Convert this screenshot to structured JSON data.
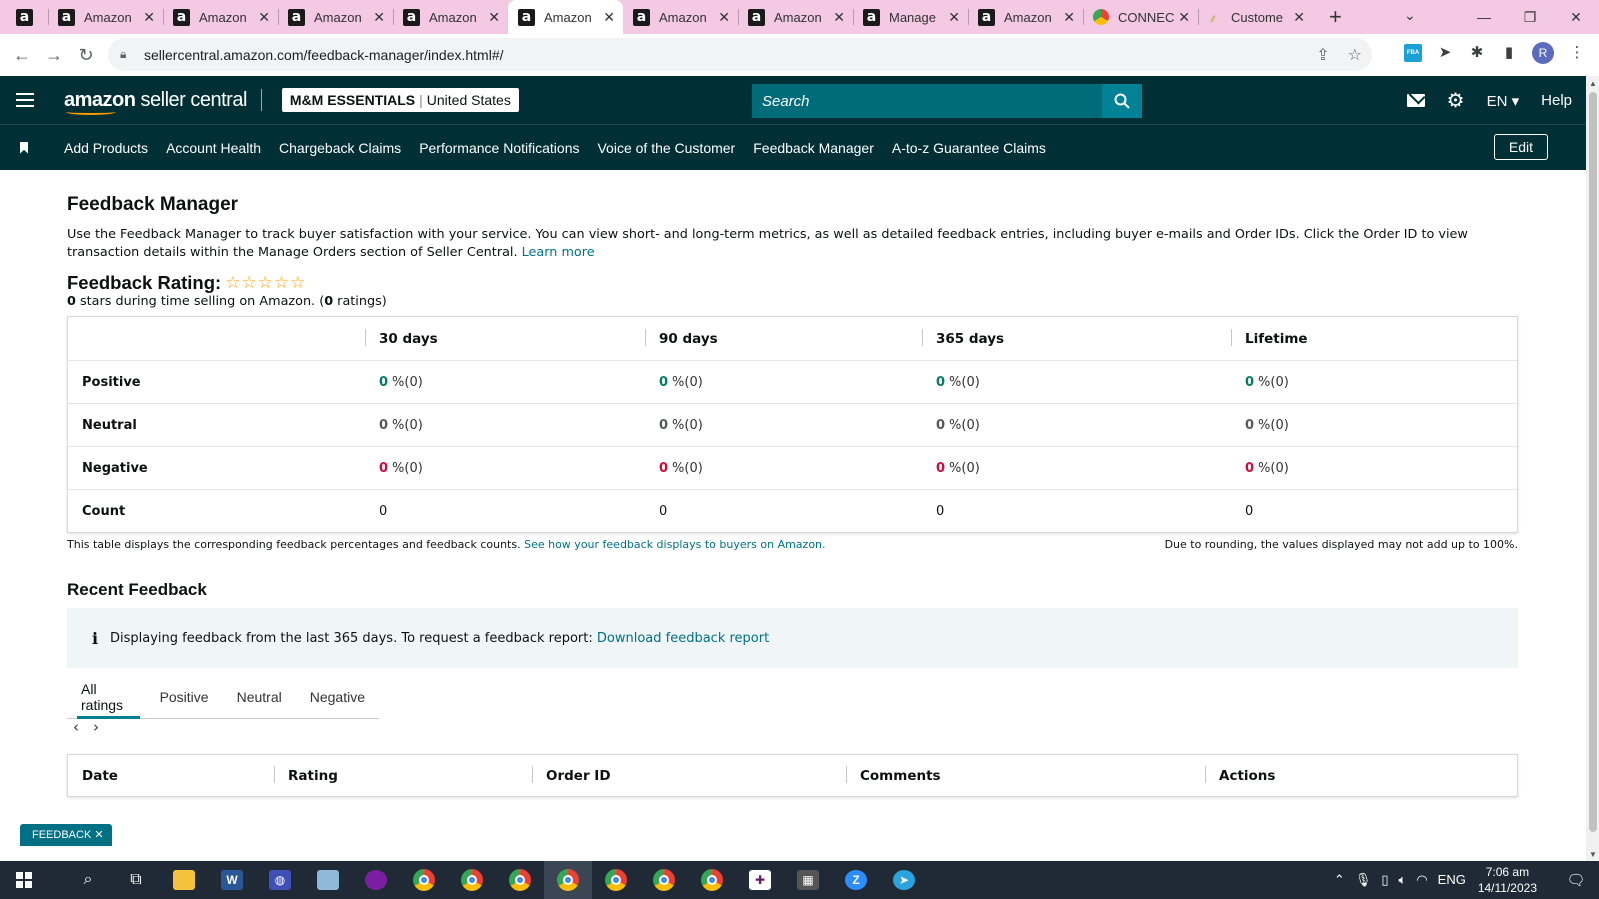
{
  "browser": {
    "tabs": [
      {
        "title": "",
        "icon": "amazon-a"
      },
      {
        "title": "Amazon",
        "icon": "amazon-a"
      },
      {
        "title": "Amazon",
        "icon": "amazon-a"
      },
      {
        "title": "Amazon",
        "icon": "amazon-a"
      },
      {
        "title": "Amazon",
        "icon": "amazon-a"
      },
      {
        "title": "Amazon",
        "icon": "amazon-a",
        "active": true
      },
      {
        "title": "Amazon",
        "icon": "amazon-a"
      },
      {
        "title": "Amazon",
        "icon": "amazon-a"
      },
      {
        "title": "Manage",
        "icon": "amazon-a"
      },
      {
        "title": "Amazon",
        "icon": "amazon-a"
      },
      {
        "title": "CONNEC",
        "icon": "chrome-round"
      },
      {
        "title": "Custome",
        "icon": "leaf"
      }
    ],
    "url": "sellercentral.amazon.com/feedback-manager/index.html#/",
    "profile_initial": "R",
    "ext_fba_label": "FBA"
  },
  "header": {
    "logo_text": "amazon",
    "logo_suffix": " seller central",
    "store_name": "M&M ESSENTIALS",
    "store_region": "United States",
    "search_placeholder": "Search",
    "language": "EN",
    "help_label": "Help"
  },
  "nav": {
    "items": [
      "Add Products",
      "Account Health",
      "Chargeback Claims",
      "Performance Notifications",
      "Voice of the Customer",
      "Feedback Manager",
      "A-to-z Guarantee Claims"
    ],
    "edit_label": "Edit"
  },
  "page": {
    "title": "Feedback Manager",
    "intro": "Use the Feedback Manager to track buyer satisfaction with your service. You can view short- and long-term metrics, as well as detailed feedback entries, including buyer e-mails and Order IDs. Click the Order ID to view transaction details within the Manage Orders section of Seller Central.",
    "learn_more": "Learn more",
    "rating_label": "Feedback Rating:",
    "stars": "☆☆☆☆☆",
    "rating_stars_value": "0",
    "rating_sub_mid": " stars during time selling on Amazon. (",
    "rating_count": "0",
    "rating_sub_end": " ratings)"
  },
  "metrics": {
    "columns": [
      "",
      "30 days",
      "90 days",
      "365 days",
      "Lifetime"
    ],
    "rows": [
      {
        "label": "Positive",
        "kind": "pos",
        "values": [
          "0",
          "0",
          "0",
          "0"
        ],
        "suffix": "%(0)"
      },
      {
        "label": "Neutral",
        "kind": "neu",
        "values": [
          "0",
          "0",
          "0",
          "0"
        ],
        "suffix": "%(0)"
      },
      {
        "label": "Negative",
        "kind": "neg",
        "values": [
          "0",
          "0",
          "0",
          "0"
        ],
        "suffix": "%(0)"
      },
      {
        "label": "Count",
        "kind": "count",
        "values": [
          "0",
          "0",
          "0",
          "0"
        ],
        "suffix": ""
      }
    ],
    "note_left": "This table displays the corresponding feedback percentages and feedback counts.",
    "note_link": "See how your feedback displays to buyers on Amazon.",
    "note_right": "Due to rounding, the values displayed may not add up to 100%."
  },
  "recent": {
    "title": "Recent Feedback",
    "info_text": "Displaying feedback from the last 365 days. To request a feedback report:",
    "info_link": "Download feedback report",
    "tabs": [
      "All ratings",
      "Positive",
      "Neutral",
      "Negative"
    ],
    "columns": [
      "Date",
      "Rating",
      "Order ID",
      "Comments",
      "Actions"
    ]
  },
  "feedback_tab": "FEEDBACK ✕",
  "taskbar": {
    "time": "7:06 am",
    "date": "14/11/2023",
    "lang": "ENG"
  },
  "colors": {
    "header_bg": "#002F36",
    "search_bg": "#006C7A",
    "link": "#007185",
    "positive": "#067D62",
    "negative": "#CC0C39"
  }
}
